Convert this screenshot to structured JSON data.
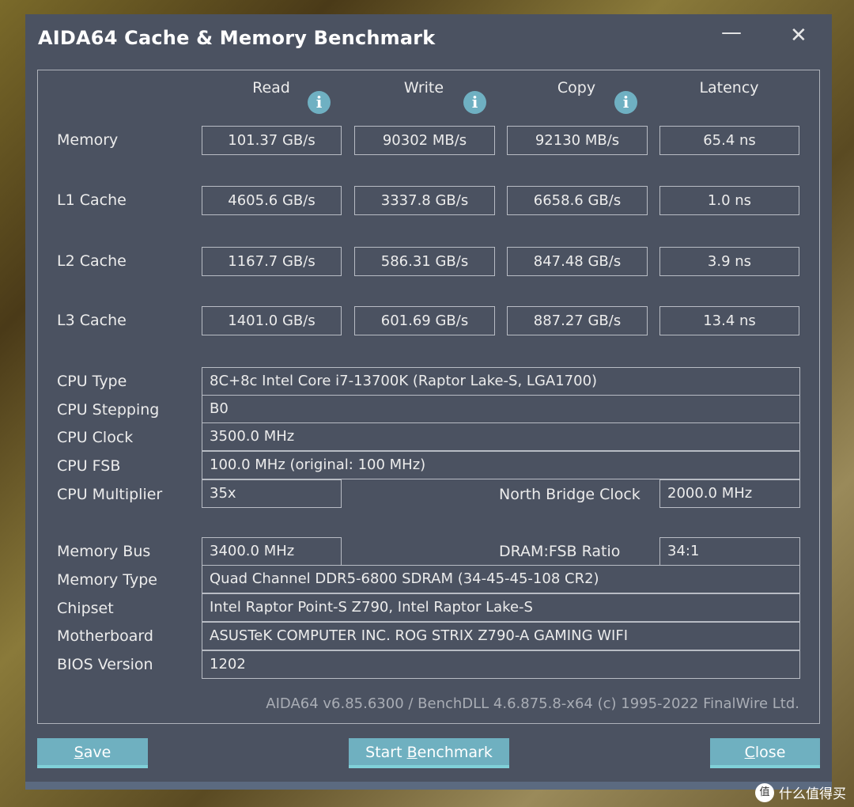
{
  "window": {
    "title": "AIDA64 Cache & Memory Benchmark",
    "minimize": "—",
    "close": "✕"
  },
  "columns": [
    "Read",
    "Write",
    "Copy",
    "Latency"
  ],
  "rows": [
    {
      "label": "Memory",
      "values": [
        "101.37 GB/s",
        "90302 MB/s",
        "92130 MB/s",
        "65.4 ns"
      ]
    },
    {
      "label": "L1 Cache",
      "values": [
        "4605.6 GB/s",
        "3337.8 GB/s",
        "6658.6 GB/s",
        "1.0 ns"
      ]
    },
    {
      "label": "L2 Cache",
      "values": [
        "1167.7 GB/s",
        "586.31 GB/s",
        "847.48 GB/s",
        "3.9 ns"
      ]
    },
    {
      "label": "L3 Cache",
      "values": [
        "1401.0 GB/s",
        "601.69 GB/s",
        "887.27 GB/s",
        "13.4 ns"
      ]
    }
  ],
  "info": {
    "cpu_type": {
      "label": "CPU Type",
      "value": "8C+8c Intel Core i7-13700K  (Raptor Lake-S, LGA1700)"
    },
    "cpu_stepping": {
      "label": "CPU Stepping",
      "value": "B0"
    },
    "cpu_clock": {
      "label": "CPU Clock",
      "value": "3500.0 MHz"
    },
    "cpu_fsb": {
      "label": "CPU FSB",
      "value": "100.0 MHz  (original: 100 MHz)"
    },
    "cpu_multiplier": {
      "label": "CPU Multiplier",
      "value": "35x"
    },
    "nb_clock": {
      "label": "North Bridge Clock",
      "value": "2000.0 MHz"
    },
    "memory_bus": {
      "label": "Memory Bus",
      "value": "3400.0 MHz"
    },
    "dram_ratio": {
      "label": "DRAM:FSB Ratio",
      "value": "34:1"
    },
    "memory_type": {
      "label": "Memory Type",
      "value": "Quad Channel DDR5-6800 SDRAM  (34-45-45-108 CR2)"
    },
    "chipset": {
      "label": "Chipset",
      "value": "Intel Raptor Point-S Z790, Intel Raptor Lake-S"
    },
    "motherboard": {
      "label": "Motherboard",
      "value": "ASUSTeK COMPUTER INC. ROG STRIX Z790-A GAMING WIFI"
    },
    "bios": {
      "label": "BIOS Version",
      "value": "1202"
    }
  },
  "footer": "AIDA64 v6.85.6300 / BenchDLL 4.6.875.8-x64  (c) 1995-2022 FinalWire Ltd.",
  "buttons": {
    "save_u": "S",
    "save_rest": "ave",
    "start_pre": "Start ",
    "start_u": "B",
    "start_rest": "enchmark",
    "close_u": "C",
    "close_rest": "lose"
  },
  "watermark": {
    "logo": "值",
    "text": "什么值得买"
  }
}
